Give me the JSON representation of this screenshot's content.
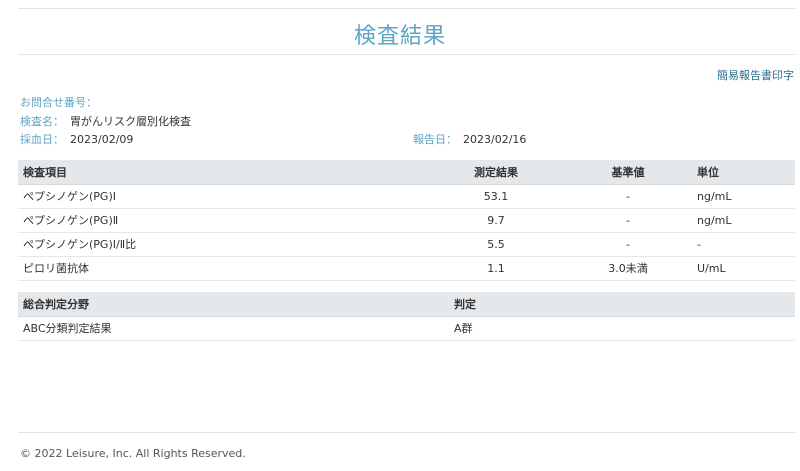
{
  "page": {
    "title": "検査結果",
    "print_link": "簡易報告書印字"
  },
  "meta": {
    "inquiry_label": "お問合せ番号：",
    "inquiry_value": "",
    "test_label": "検査名：",
    "test_value": "胃がんリスク層別化検査",
    "date_label": "採血日：",
    "date_value": "2023/02/09",
    "report_label": "報告日：",
    "report_value": "2023/02/16"
  },
  "results": {
    "headers": [
      "検査項目",
      "測定結果",
      "基準値",
      "単位"
    ],
    "rows": [
      [
        "ペプシノゲン(PG)Ⅰ",
        "53.1",
        "-",
        "ng/mL"
      ],
      [
        "ペプシノゲン(PG)Ⅱ",
        "9.7",
        "-",
        "ng/mL"
      ],
      [
        "ペプシノゲン(PG)Ⅰ/Ⅱ比",
        "5.5",
        "-",
        "-"
      ],
      [
        "ピロリ菌抗体",
        "1.1",
        "3.0未満",
        "U/mL"
      ]
    ]
  },
  "judgement": {
    "headers": [
      "総合判定分野",
      "判定"
    ],
    "rows": [
      [
        "ABC分類判定結果",
        "A群"
      ]
    ]
  },
  "footer": {
    "copyright": "© 2022 Leisure, Inc. All Rights Reserved."
  },
  "colors": {
    "accent": "#5ea5c4",
    "link": "#2b6e8f",
    "header_bg": "#e4e8eb"
  }
}
